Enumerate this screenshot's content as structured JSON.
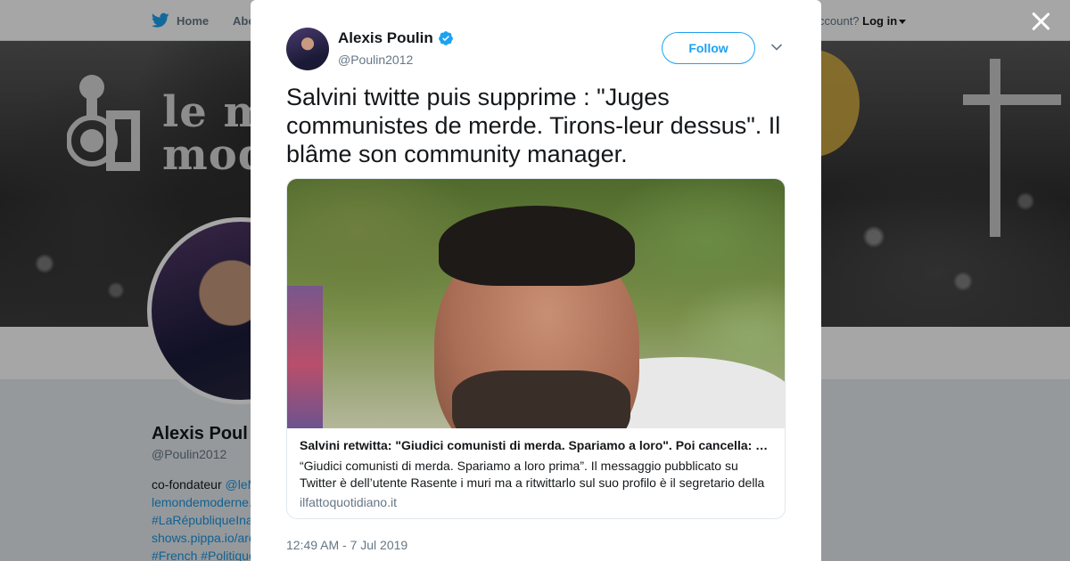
{
  "background": {
    "nav": {
      "home": "Home",
      "about": "Abo",
      "login_prompt": "ccount?",
      "login": "Log in"
    },
    "banner_logo": {
      "line1": "le mo",
      "line2": "mode"
    },
    "profile": {
      "name": "Alexis Poul",
      "handle": "@Poulin2012",
      "bio_lines": [
        {
          "text": "co-fondateur ",
          "link": "@leM"
        },
        {
          "text": "",
          "link": "lemondemoderne."
        },
        {
          "text": "",
          "link": "#LaRépubliqueIna"
        },
        {
          "text": "",
          "link": "shows.pippa.io/arc"
        },
        {
          "text": "",
          "link": "#French #Politique"
        }
      ]
    }
  },
  "modal": {
    "author": {
      "name": "Alexis Poulin",
      "handle": "@Poulin2012",
      "verified": true
    },
    "follow_label": "Follow",
    "tweet_text": "Salvini twitte puis supprime : \"Juges communistes de merde. Tirons-leur dessus\". Il blâme son community manager.",
    "card": {
      "title": "Salvini retwitta: \"Giudici comunisti di merda. Spariamo a loro\". Poi cancella: …",
      "description": "“Giudici comunisti di merda. Spariamo a loro prima”. Il messaggio pubblicato su Twitter è dell’utente Rasente i muri ma a ritwittarlo sul suo profilo è il segretario della",
      "domain": "ilfattoquotidiano.it"
    },
    "timestamp": "12:49 AM - 7 Jul 2019"
  },
  "colors": {
    "accent": "#1da1f2",
    "text": "#14171a",
    "muted": "#657786"
  },
  "icons": [
    "twitter-bird-icon",
    "verified-badge-icon",
    "chevron-down-icon",
    "close-icon"
  ]
}
